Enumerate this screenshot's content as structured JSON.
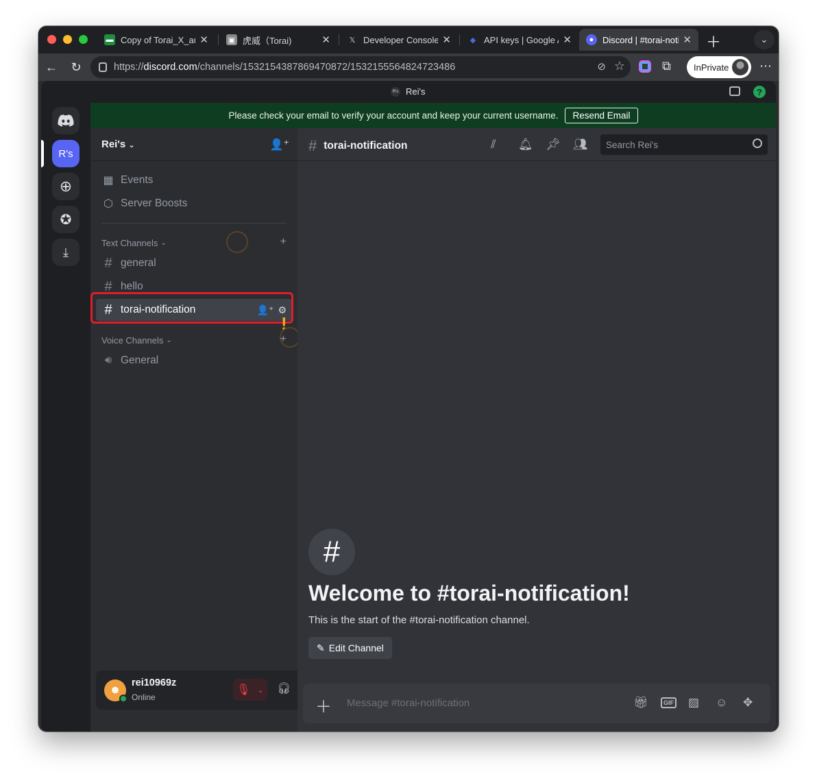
{
  "browser": {
    "tabs": [
      {
        "title": "Copy of Torai_X_auto",
        "favicon_color": "#1e8e3e",
        "active": false
      },
      {
        "title": "虎威（Torai)",
        "favicon_color": "#888888",
        "active": false
      },
      {
        "title": "Developer Console",
        "favicon_color": "#2b2c30",
        "active": false
      },
      {
        "title": "API keys | Google AI",
        "favicon_color": "#4b6bd8",
        "active": false
      },
      {
        "title": "Discord | #torai-notif",
        "favicon_color": "#5865f2",
        "active": true
      }
    ],
    "url_prefix": "https://",
    "url_host": "discord.com",
    "url_path": "/channels/1532154387869470872/1532155564824723486",
    "inprivate_label": "InPrivate"
  },
  "discord": {
    "window_title": "Rei's",
    "banner_text": "Please check your email to verify your account and keep your current username.",
    "banner_button": "Resend Email",
    "server_rail": {
      "selected_label": "R's"
    },
    "server": {
      "name": "Rei's",
      "top_items": [
        {
          "label": "Events",
          "icon": "calendar-icon"
        },
        {
          "label": "Server Boosts",
          "icon": "boost-icon"
        }
      ],
      "text_category": "Text Channels",
      "text_channels": [
        "general",
        "hello",
        "torai-notification"
      ],
      "selected_channel": "torai-notification",
      "voice_category": "Voice Channels",
      "voice_channels": [
        "General"
      ]
    },
    "user": {
      "username": "rei10969z",
      "status": "Online"
    },
    "channel_header": {
      "name": "torai-notification",
      "search_placeholder": "Search Rei's"
    },
    "welcome": {
      "title": "Welcome to #torai-notification!",
      "subtitle": "This is the start of the #torai-notification channel.",
      "edit_button": "Edit Channel"
    },
    "composer": {
      "placeholder": "Message #torai-notification",
      "gif_label": "GIF"
    },
    "colors": {
      "blurple": "#5865f2",
      "banner": "#0f3d22",
      "highlight": "#e11d2b",
      "online": "#23a55a"
    }
  }
}
